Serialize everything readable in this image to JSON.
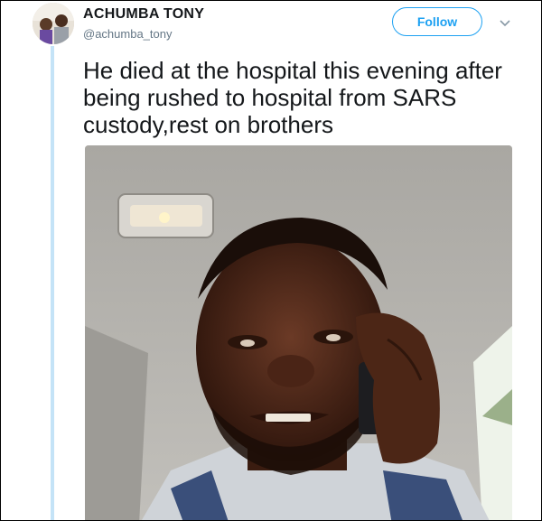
{
  "tweet": {
    "author": {
      "display_name": "ACHUMBA TONY",
      "handle": "@achumba_tony",
      "avatar_icon": "user-avatar-photo"
    },
    "follow_label": "Follow",
    "menu_icon": "chevron-down-icon",
    "text": "He died at the hospital this evening after being rushed to hospital from SARS custody,rest on brothers",
    "media": {
      "type": "photo",
      "icon": "photo-image"
    }
  },
  "colors": {
    "accent": "#1da1f2",
    "text": "#14171a",
    "muted": "#657786",
    "thread_line": "#c4e3f7"
  }
}
